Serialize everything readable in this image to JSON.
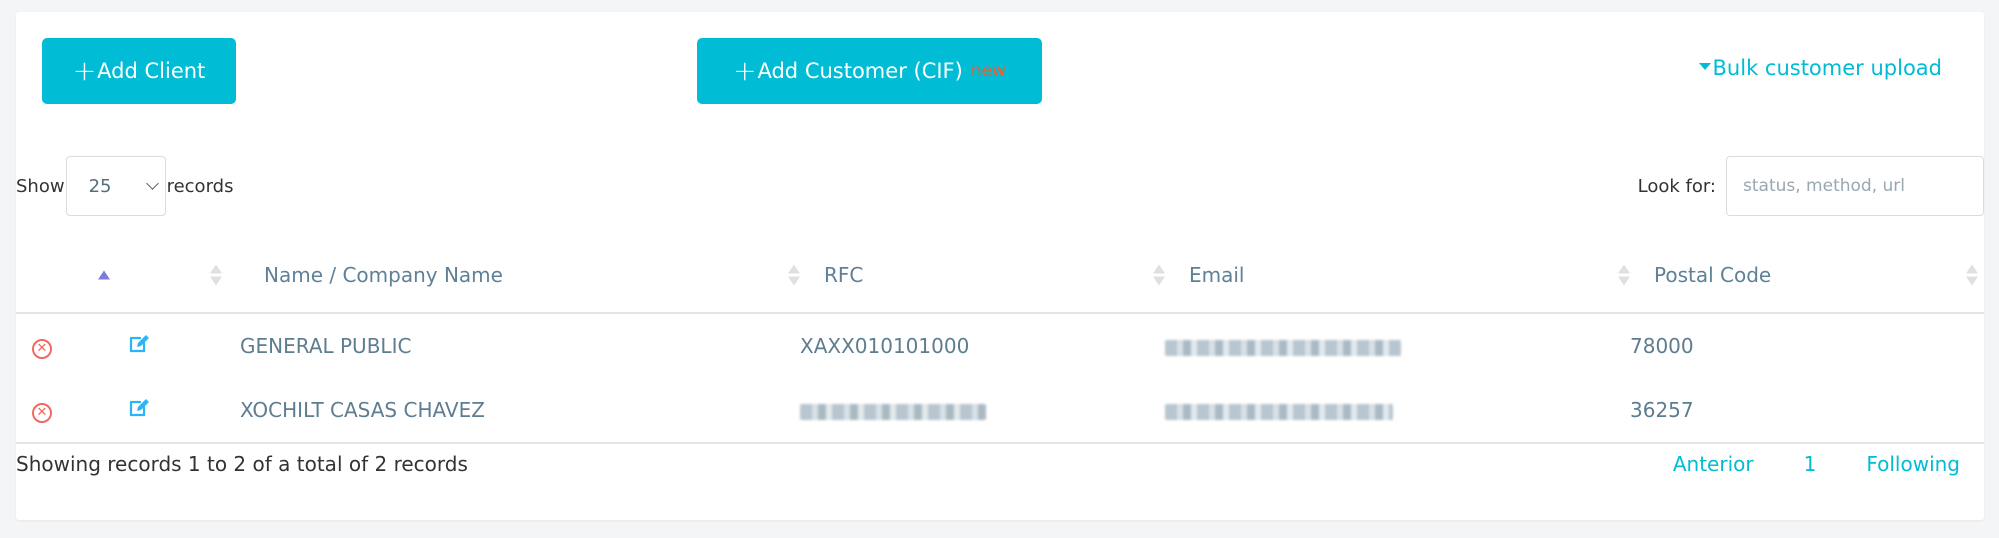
{
  "toolbar": {
    "add_client_label": "Add Client",
    "add_customer_label": "Add Customer (CIF)",
    "add_customer_badge": "new",
    "bulk_upload_label": "Bulk customer upload"
  },
  "length_control": {
    "prefix": "Show",
    "selected": "25",
    "suffix": "records"
  },
  "search": {
    "label": "Look for:",
    "value": "",
    "placeholder": "status, method, url"
  },
  "table": {
    "columns": [
      {
        "key": "delete",
        "label": ""
      },
      {
        "key": "edit",
        "label": ""
      },
      {
        "key": "name",
        "label": "Name / Company Name"
      },
      {
        "key": "rfc",
        "label": "RFC"
      },
      {
        "key": "email",
        "label": "Email"
      },
      {
        "key": "postal_code",
        "label": "Postal Code"
      }
    ],
    "sort": {
      "column": "delete",
      "direction": "asc"
    },
    "rows": [
      {
        "name": "GENERAL PUBLIC",
        "rfc": "XAXX010101000",
        "rfc_redacted": false,
        "email": "[redacted]",
        "email_redacted": true,
        "postal_code": "78000"
      },
      {
        "name": "XOCHILT CASAS CHAVEZ",
        "rfc": "[redacted]",
        "rfc_redacted": true,
        "email": "[redacted]",
        "email_redacted": true,
        "postal_code": "36257"
      }
    ]
  },
  "footer": {
    "info": "Showing records 1 to 2 of a total of 2 records",
    "pagination": {
      "previous": "Anterior",
      "current_page": "1",
      "next": "Following"
    }
  },
  "colors": {
    "accent": "#00bcd4",
    "badge": "#ff5722",
    "delete": "#f06a60",
    "edit": "#29b6f6",
    "sort_active": "#7b7be0"
  }
}
